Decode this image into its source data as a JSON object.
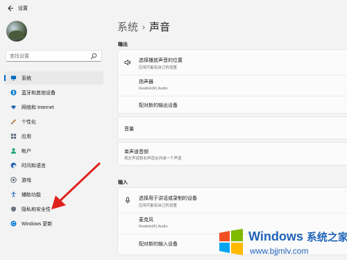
{
  "window": {
    "title": "设置"
  },
  "search": {
    "placeholder": "查找设置"
  },
  "sidebar": {
    "items": [
      {
        "label": "系统",
        "icon": "monitor-icon",
        "color": "#0067c0",
        "selected": true
      },
      {
        "label": "蓝牙和其他设备",
        "icon": "bluetooth-icon",
        "color": "#0078d4"
      },
      {
        "label": "网络和 Internet",
        "icon": "wifi-icon",
        "color": "#2b6cb0"
      },
      {
        "label": "个性化",
        "icon": "brush-icon",
        "color": "#c47a34"
      },
      {
        "label": "应用",
        "icon": "apps-icon",
        "color": "#5a6a7a"
      },
      {
        "label": "帐户",
        "icon": "person-icon",
        "color": "#1aa37a"
      },
      {
        "label": "时间和语言",
        "icon": "globe-clock-icon",
        "color": "#2563b0"
      },
      {
        "label": "游戏",
        "icon": "gamepad-icon",
        "color": "#4b5563"
      },
      {
        "label": "辅助功能",
        "icon": "accessibility-icon",
        "color": "#1f6fb5"
      },
      {
        "label": "隐私和安全性",
        "icon": "shield-icon",
        "color": "#6b7280"
      },
      {
        "label": "Windows 更新",
        "icon": "update-icon",
        "color": "#0078d4"
      }
    ]
  },
  "breadcrumb": {
    "parent": "系统",
    "separator": "›",
    "current": "声音"
  },
  "output": {
    "section_label": "输出",
    "choose": {
      "title": "选择播放声音的位置",
      "subtitle": "应用可能有自己的设置"
    },
    "device": {
      "name": "扬声器",
      "detail": "Realtek(R) Audio"
    },
    "pair_link": "配对新的输出设备",
    "volume_label": "音量",
    "mono": {
      "title": "单声道音频",
      "subtitle": "将左声道和右声道合并成一个声道"
    }
  },
  "input": {
    "section_label": "输入",
    "choose": {
      "title": "选择用于讲话或录制的设备",
      "subtitle": "应用可能有自己的设置"
    },
    "device": {
      "name": "麦克风",
      "detail": "Realtek(R) Audio"
    },
    "pair_link": "配对新的输入设备"
  },
  "watermark": {
    "brand": "Windows",
    "brand_cn": "系统之家",
    "url": "www.bjjmlv.com"
  },
  "colors": {
    "accent": "#0067c0",
    "annotation_arrow": "#e0201c",
    "watermark": "#1e63b8"
  }
}
